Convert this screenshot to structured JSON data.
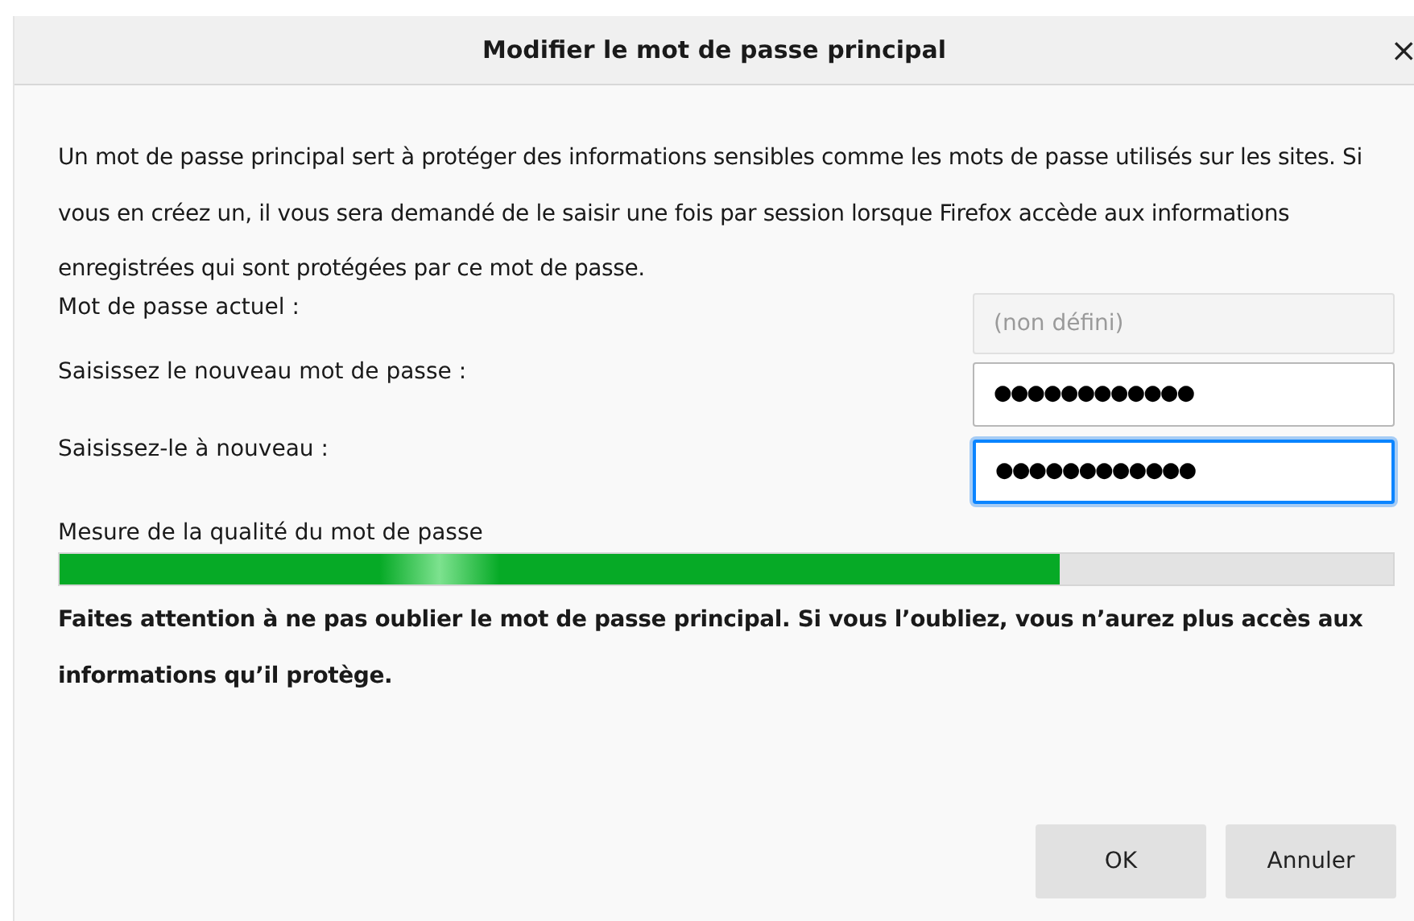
{
  "window": {
    "title": "Modifier le mot de passe principal",
    "close": "×"
  },
  "description": "Un mot de passe principal sert à protéger des informations sensibles comme les mots de passe utilisés sur les sites. Si vous en créez un, il vous sera demandé de le saisir une fois par session lorsque Firefox accède aux informations enregistrées qui sont protégées par ce mot de passe.",
  "fields": [
    {
      "label": "Mot de passe actuel :",
      "placeholder": "(non défini)",
      "disabled": true,
      "focused": false
    },
    {
      "label": "Saisissez le nouveau mot de passe :",
      "value": "●●●●●●●●●●●●",
      "disabled": false,
      "focused": false
    },
    {
      "label": "Saisissez-le à nouveau :",
      "value": "●●●●●●●●●●●●",
      "disabled": false,
      "focused": true
    }
  ],
  "quality": {
    "label": "Mesure de la qualité du mot de passe",
    "level": 0.75
  },
  "warning": "Faites attention à ne pas oublier le mot de passe principal. Si vous l’oubliez, vous n’aurez plus accès aux informations qu’il protège.",
  "buttons": [
    "OK",
    "Annuler"
  ]
}
